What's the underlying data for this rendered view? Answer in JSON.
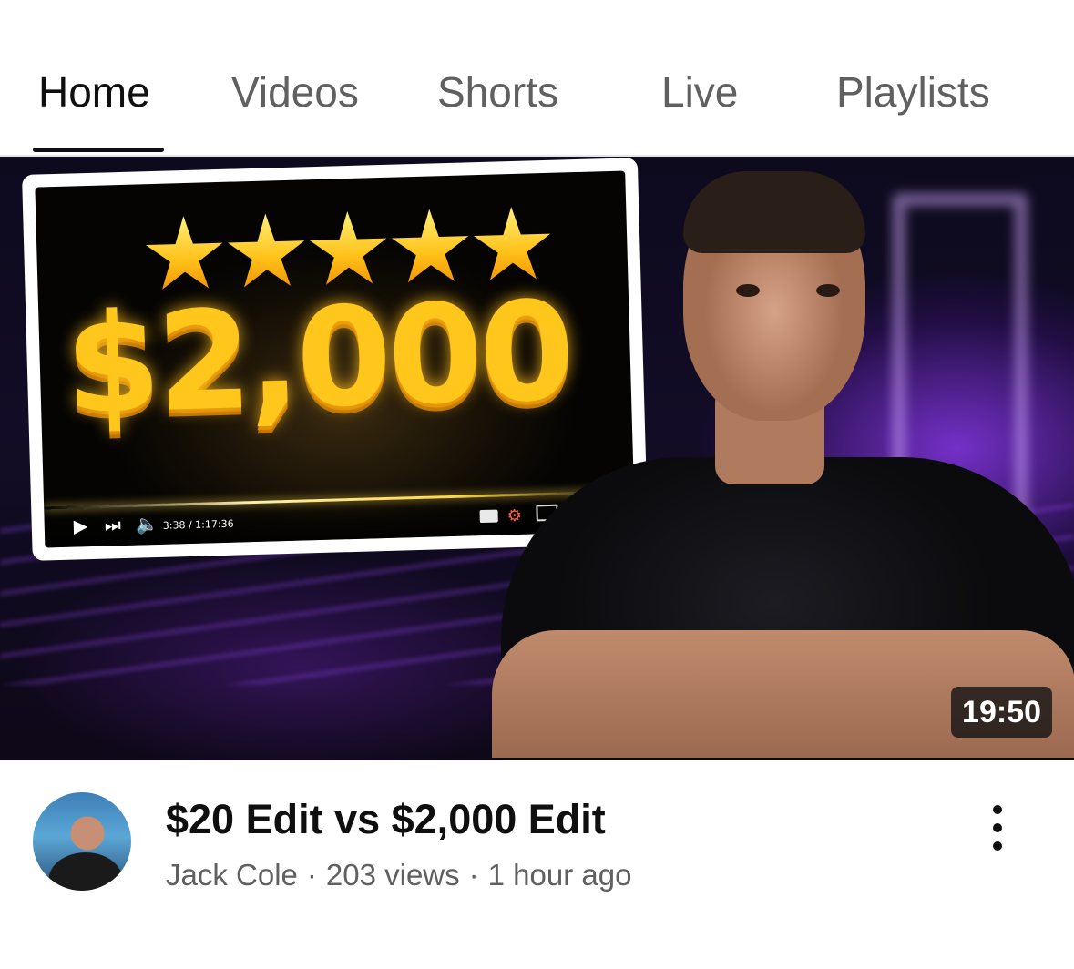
{
  "tabs": [
    {
      "label": "Home",
      "active": true
    },
    {
      "label": "Videos",
      "active": false
    },
    {
      "label": "Shorts",
      "active": false
    },
    {
      "label": "Live",
      "active": false
    },
    {
      "label": "Playlists",
      "active": false
    }
  ],
  "video": {
    "thumbnail": {
      "price_text": "$2,000",
      "star_count": 5,
      "player_time": "3:38 / 1:17:36",
      "duration": "19:50"
    },
    "title": "$20 Edit vs $2,000 Edit",
    "channel": "Jack Cole",
    "views": "203 views",
    "age": "1 hour ago",
    "separator": "·"
  },
  "icons": {
    "more": "more-vertical-icon",
    "avatar": "channel-avatar"
  },
  "colors": {
    "text_primary": "#0f0f0f",
    "text_secondary": "#606060",
    "accent_gold": "#ffc61c"
  }
}
